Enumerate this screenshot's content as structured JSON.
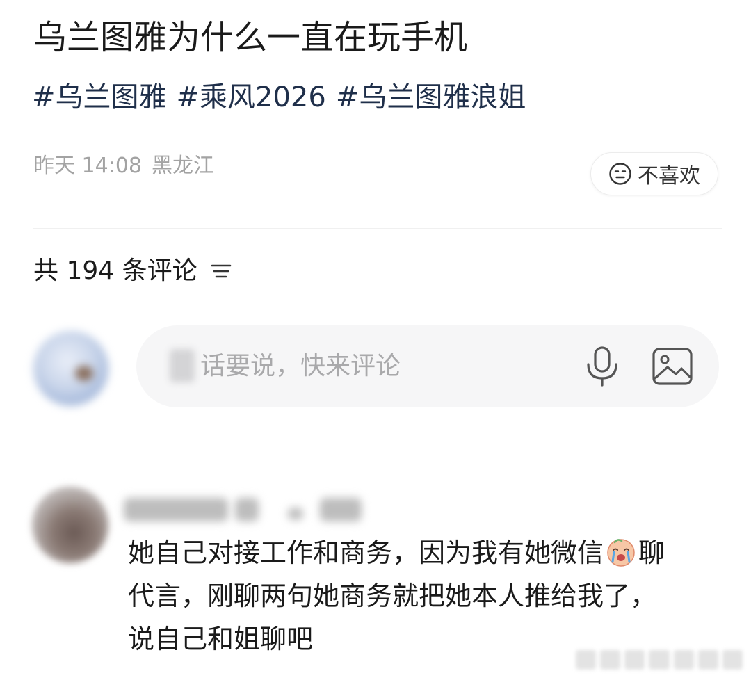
{
  "post": {
    "title": "乌兰图雅为什么一直在玩手机",
    "tags": [
      "#乌兰图雅",
      "#乘风2026",
      "#乌兰图雅浪姐"
    ],
    "date": "昨天 14:08",
    "location": "黑龙江",
    "dislike_label": "不喜欢",
    "dislike_icon": "neutral-face-icon"
  },
  "comments": {
    "header": "共 194 条评论",
    "sort_icon": "sort-lines-icon",
    "input_placeholder": "话要说，快来评论",
    "mic_icon": "microphone-icon",
    "image_icon": "image-icon"
  },
  "comment_item": {
    "text_lines": [
      "她自己对接工作和商务，因为我有她微信",
      "聊",
      "代言，刚聊两句她商务就把她本人推给我了，",
      "说自己和姐聊吧"
    ],
    "emoji_icon": "crying-face-emoji-icon"
  },
  "colors": {
    "title": "#1a1a1a",
    "tag": "#1f2f4a",
    "meta": "#a3a3a3",
    "placeholder": "#a9a9ab",
    "input_bg": "#f6f6f7"
  }
}
